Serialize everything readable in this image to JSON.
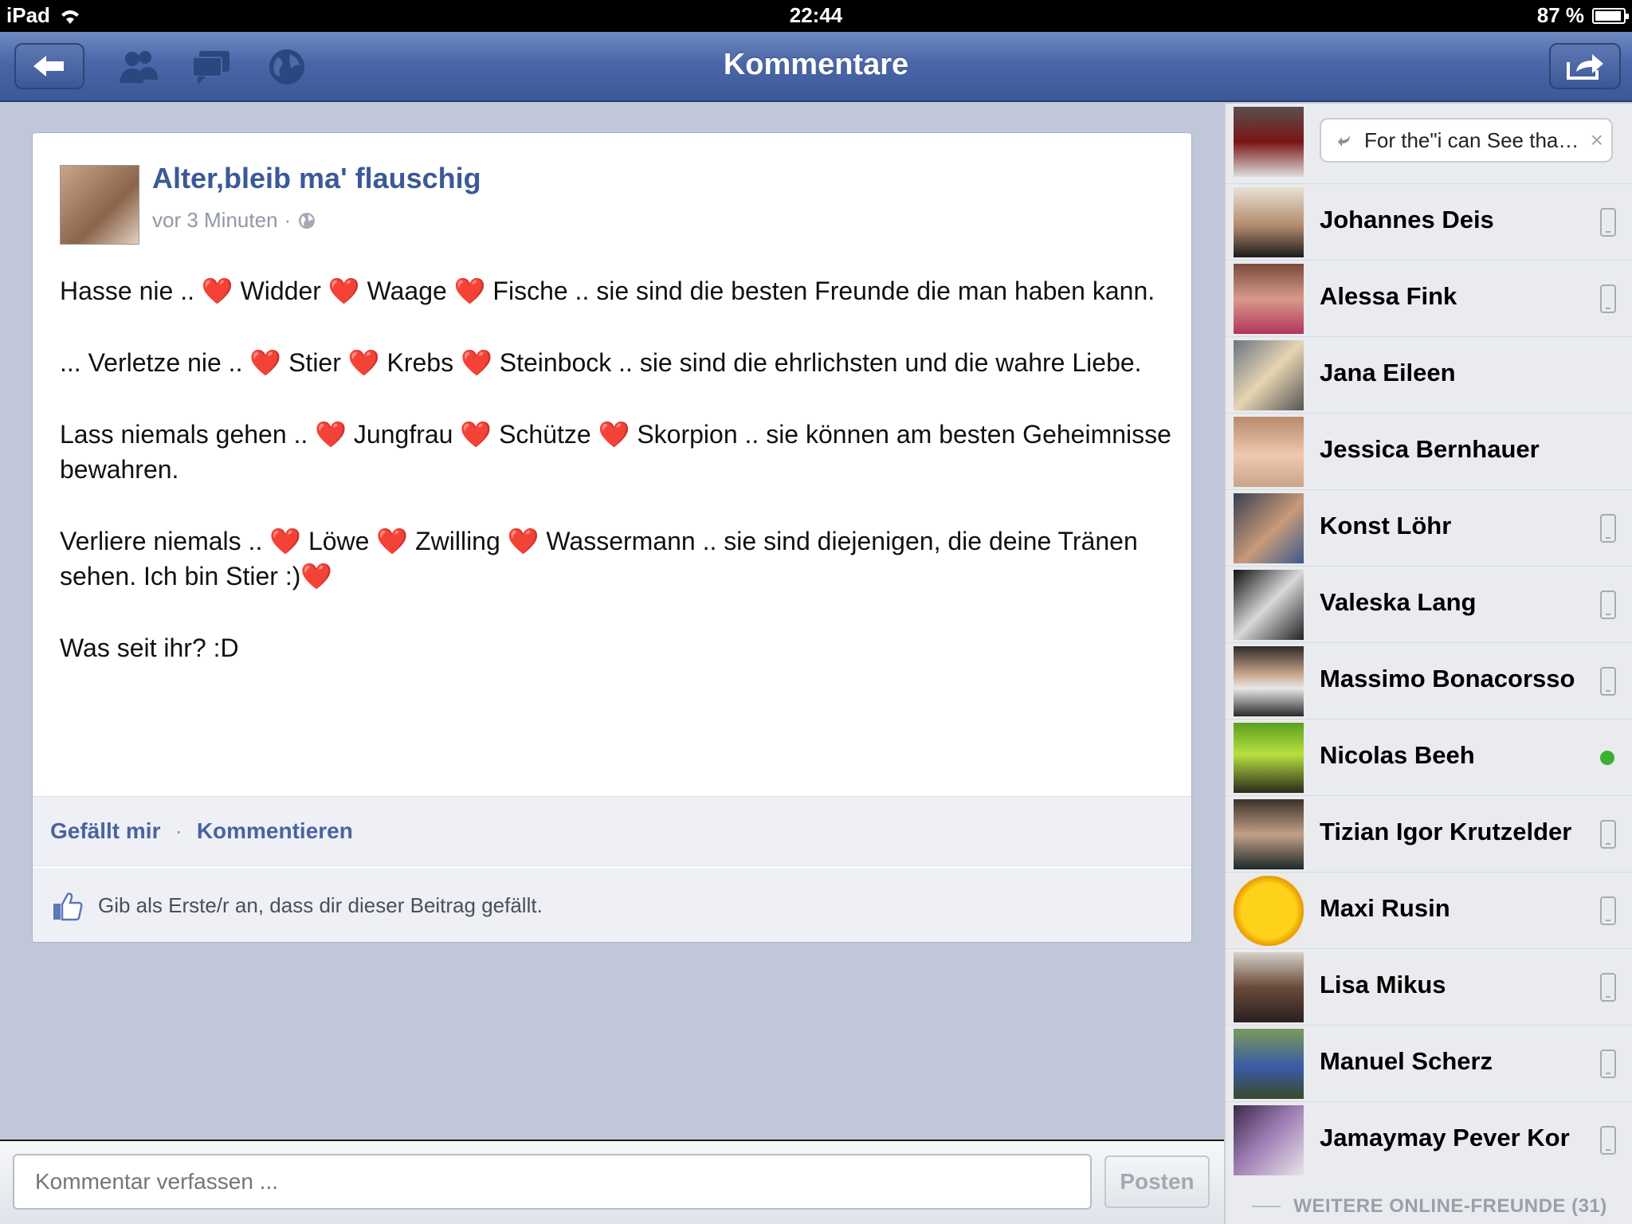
{
  "statusbar": {
    "device": "iPad",
    "time": "22:44",
    "battery": "87 %",
    "battery_level": 0.87
  },
  "navbar": {
    "title": "Kommentare"
  },
  "post": {
    "author": "Alter,bleib ma' flauschig",
    "time": "vor 3 Minuten",
    "paragraphs": [
      "Hasse nie .. ❤️ Widder ❤️ Waage ❤️ Fische .. sie sind die besten Freunde die man haben kann.",
      "... Verletze nie .. ❤️ Stier ❤️ Krebs ❤️ Steinbock .. sie sind die ehrlichsten und die wahre Liebe.",
      "Lass niemals gehen .. ❤️ Jungfrau ❤️ Schütze ❤️ Skorpion .. sie können am besten Geheimnisse bewahren.",
      "Verliere niemals .. ❤️ Löwe ❤️ Zwilling ❤️ Wassermann .. sie sind diejenigen, die deine Tränen sehen. Ich bin Stier :)❤️",
      "Was seit ihr? :D"
    ],
    "like_label": "Gefällt mir",
    "separator": "·",
    "comment_label": "Kommentieren",
    "like_prompt": "Gib als Erste/r an, dass dir dieser Beitrag gefällt."
  },
  "comment_bar": {
    "placeholder": "Kommentar verfassen ...",
    "post_label": "Posten"
  },
  "sidebar": {
    "chat_preview": "For the\"i can See that...",
    "friends": [
      {
        "name": "Johannes Deis",
        "status": "mobile"
      },
      {
        "name": "Alessa Fink",
        "status": "mobile"
      },
      {
        "name": "Jana Eileen",
        "status": "none"
      },
      {
        "name": "Jessica Bernhauer",
        "status": "none"
      },
      {
        "name": "Konst Löhr",
        "status": "mobile"
      },
      {
        "name": "Valeska Lang",
        "status": "mobile"
      },
      {
        "name": "Massimo Bonacorsso",
        "status": "mobile"
      },
      {
        "name": "Nicolas Beeh",
        "status": "online"
      },
      {
        "name": "Tizian Igor Krutzelder",
        "status": "mobile"
      },
      {
        "name": "Maxi Rusin",
        "status": "mobile"
      },
      {
        "name": "Lisa Mikus",
        "status": "mobile"
      },
      {
        "name": "Manuel Scherz",
        "status": "mobile"
      },
      {
        "name": "Jamaymay Pever Kor",
        "status": "mobile"
      }
    ],
    "more_online": "WEITERE ONLINE-FREUNDE (31)"
  },
  "colors": {
    "brand": "#3b5998",
    "link": "#4a63a0",
    "online": "#3bb12f"
  }
}
